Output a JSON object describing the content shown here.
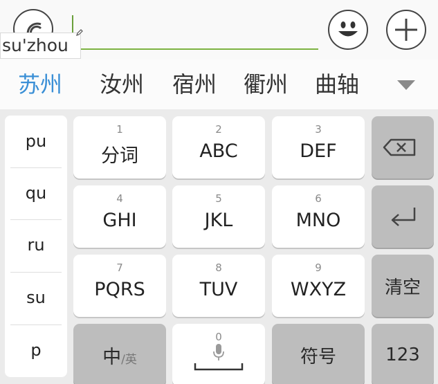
{
  "input": {
    "pinyin_composition": "su'zhou"
  },
  "candidates": {
    "items": [
      "苏州",
      "汝州",
      "宿州",
      "衢州",
      "曲轴"
    ]
  },
  "pinyin_list": {
    "items": [
      "pu",
      "qu",
      "ru",
      "su",
      "p"
    ]
  },
  "keys": {
    "k1": {
      "num": "1",
      "label": "分词"
    },
    "k2": {
      "num": "2",
      "label": "ABC"
    },
    "k3": {
      "num": "3",
      "label": "DEF"
    },
    "k4": {
      "num": "4",
      "label": "GHI"
    },
    "k5": {
      "num": "5",
      "label": "JKL"
    },
    "k6": {
      "num": "6",
      "label": "MNO"
    },
    "k7": {
      "num": "7",
      "label": "PQRS"
    },
    "k8": {
      "num": "8",
      "label": "TUV"
    },
    "k9": {
      "num": "9",
      "label": "WXYZ"
    },
    "k0": {
      "num": "0"
    },
    "clear": "清空",
    "lang_main": "中",
    "lang_sub": "/英",
    "symbols": "符号",
    "numbers": "123"
  },
  "icons": {
    "voice": "voice-wave-icon",
    "emoji": "smiley-icon",
    "plus": "plus-icon",
    "expand": "triangle-down-icon",
    "backspace": "backspace-icon",
    "enter": "enter-icon",
    "mic": "microphone-icon",
    "space": "space-bar-icon"
  },
  "colors": {
    "candidate_highlight": "#3a8fd6",
    "input_underline": "#7cb342",
    "gray_key": "#bdbdbd"
  }
}
